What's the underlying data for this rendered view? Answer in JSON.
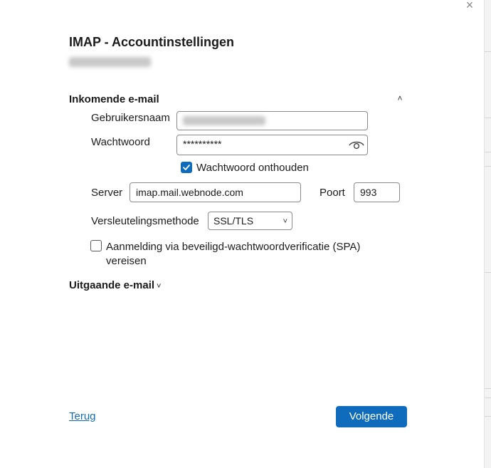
{
  "dialog": {
    "close_glyph": "×",
    "title": "IMAP - Accountinstellingen",
    "account_email": "contact@example.nl"
  },
  "incoming": {
    "section_title": "Inkomende e-mail",
    "collapse_glyph": "˄",
    "username_label": "Gebruikersnaam",
    "username_value": "contact@example.nl",
    "password_label": "Wachtwoord",
    "password_value": "**********",
    "remember_password_label": "Wachtwoord onthouden",
    "remember_password_checked": true,
    "server_label": "Server",
    "server_value": "imap.mail.webnode.com",
    "port_label": "Poort",
    "port_value": "993",
    "encryption_label": "Versleutelingsmethode",
    "encryption_value": "SSL/TLS",
    "spa_label_line1": "Aanmelding via beveiligd-wachtwoordverificatie (SPA)",
    "spa_label_line2": "vereisen",
    "spa_checked": false
  },
  "outgoing": {
    "section_title": "Uitgaande e-mail",
    "expand_glyph": "˅"
  },
  "footer": {
    "back_label": "Terug",
    "next_label": "Volgende"
  },
  "colors": {
    "accent": "#0f6cbd",
    "border": "#8a8a8a"
  }
}
